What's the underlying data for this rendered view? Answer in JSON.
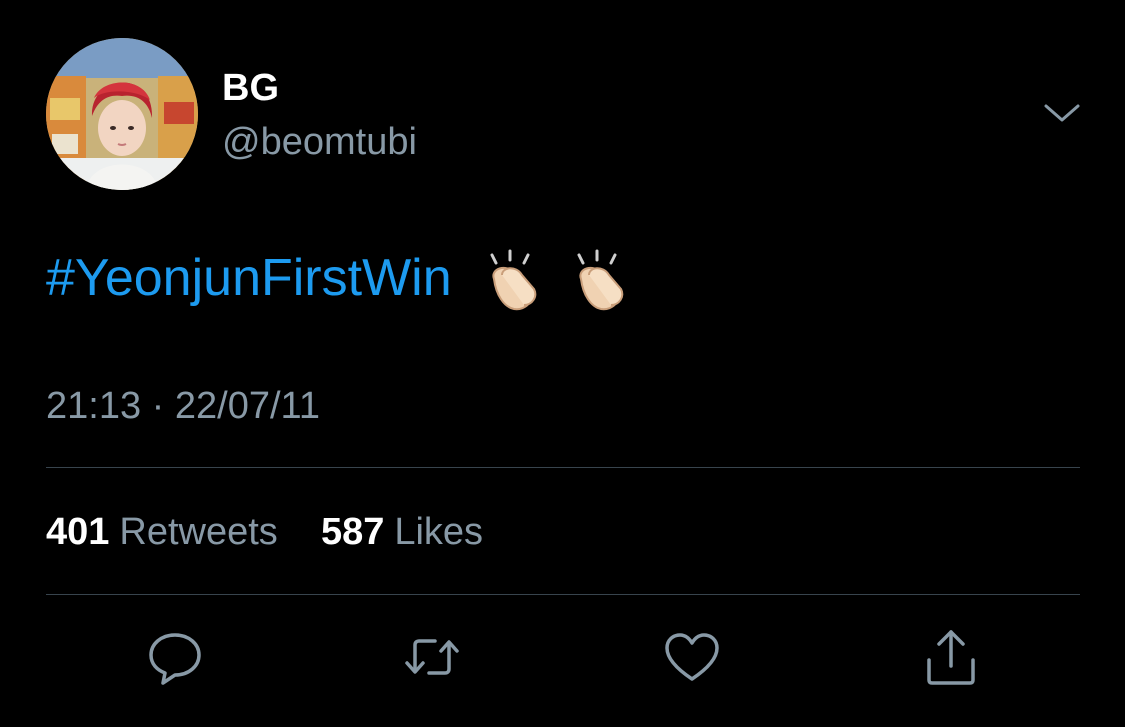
{
  "tweet": {
    "display_name": "BG",
    "handle": "@beomtubi",
    "hashtag": "#YeonjunFirstWin",
    "emoji_icon": "clapping-hands-emoji",
    "timestamp": "21:13 · 22/07/11"
  },
  "stats": {
    "retweets_count": "401",
    "retweets_label": "Retweets",
    "likes_count": "587",
    "likes_label": "Likes"
  },
  "actions": [
    "reply-icon",
    "retweet-icon",
    "like-icon",
    "share-icon"
  ],
  "colors": {
    "background": "#000000",
    "hashtag": "#1d9bf0",
    "secondary_text": "#8899a6",
    "divider": "#38444d",
    "icon": "#8899a6"
  }
}
